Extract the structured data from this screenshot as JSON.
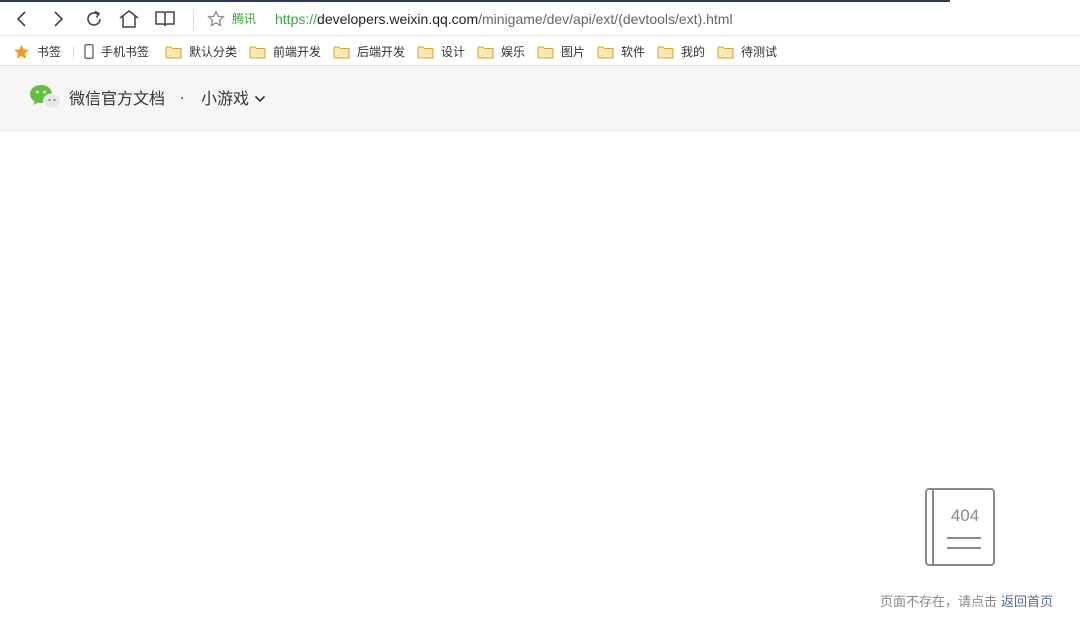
{
  "browser": {
    "site_tag": "腾讯",
    "url": {
      "scheme": "https://",
      "host": "developers.weixin.qq.com",
      "path": "/minigame/dev/api/ext/(devtools/ext).html"
    }
  },
  "bookmarks": {
    "main": "书签",
    "items": [
      "手机书签",
      "默认分类",
      "前端开发",
      "后端开发",
      "设计",
      "娱乐",
      "图片",
      "软件",
      "我的",
      "待测试"
    ]
  },
  "header": {
    "brand": "微信官方文档",
    "separator": "·",
    "section": "小游戏"
  },
  "not_found": {
    "code": "404",
    "message": "页面不存在，请点击",
    "link": "返回首页"
  },
  "colors": {
    "brand_green": "#62c03e",
    "link_blue": "#576b95",
    "bookmark_star": "#f39a1b",
    "folder": "#f4cd6f"
  }
}
